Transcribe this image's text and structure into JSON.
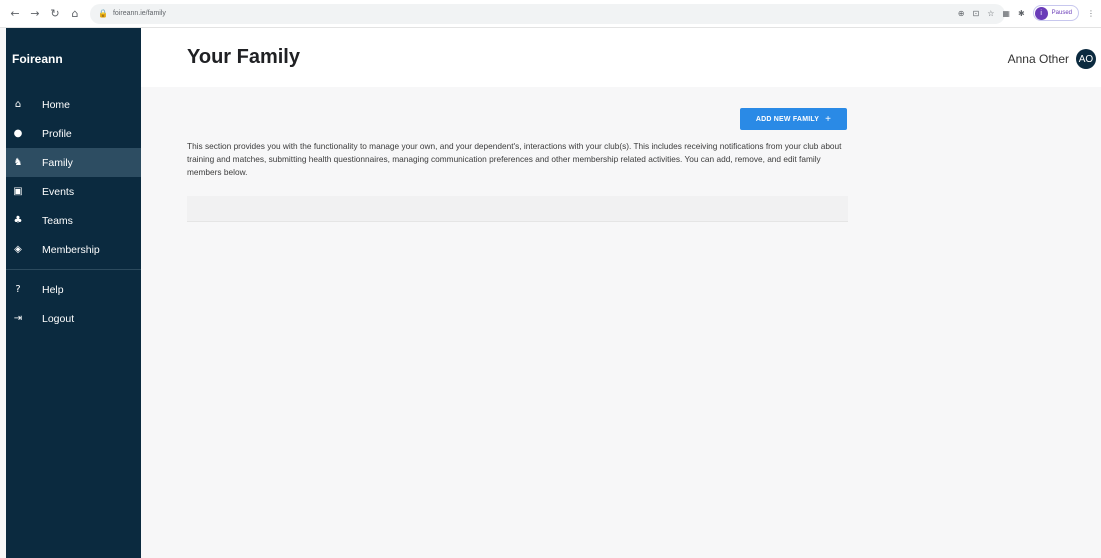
{
  "browser": {
    "url": "foireann.ie/family",
    "profile_initial": "i",
    "profile_status": "Paused"
  },
  "sidebar": {
    "brand": "Foireann",
    "items": [
      {
        "label": "Home",
        "icon": "home-icon",
        "glyph": "⌂"
      },
      {
        "label": "Profile",
        "icon": "person-icon",
        "glyph": "●"
      },
      {
        "label": "Family",
        "icon": "family-icon",
        "glyph": "♞"
      },
      {
        "label": "Events",
        "icon": "calendar-icon",
        "glyph": "▣"
      },
      {
        "label": "Teams",
        "icon": "group-icon",
        "glyph": "♣"
      },
      {
        "label": "Membership",
        "icon": "shield-icon",
        "glyph": "◈"
      }
    ],
    "secondary": [
      {
        "label": "Help",
        "icon": "help-icon",
        "glyph": "?"
      },
      {
        "label": "Logout",
        "icon": "logout-icon",
        "glyph": "⇥"
      }
    ],
    "active": "Family"
  },
  "header": {
    "title": "Your Family",
    "user_name": "Anna Other",
    "user_initials": "AO"
  },
  "main": {
    "add_button_label": "ADD NEW FAMILY",
    "add_button_icon": "+",
    "description": "This section provides you with the functionality to manage your own, and your dependent's, interactions with your club(s). This includes receiving notifications from your club about training and matches, submitting health questionnaires, managing communication preferences and other membership related activities. You can add, remove, and edit family members below."
  },
  "colors": {
    "sidebar_bg": "#0b2a3f",
    "sidebar_active": "#2d4d62",
    "accent": "#2a8ae6"
  }
}
